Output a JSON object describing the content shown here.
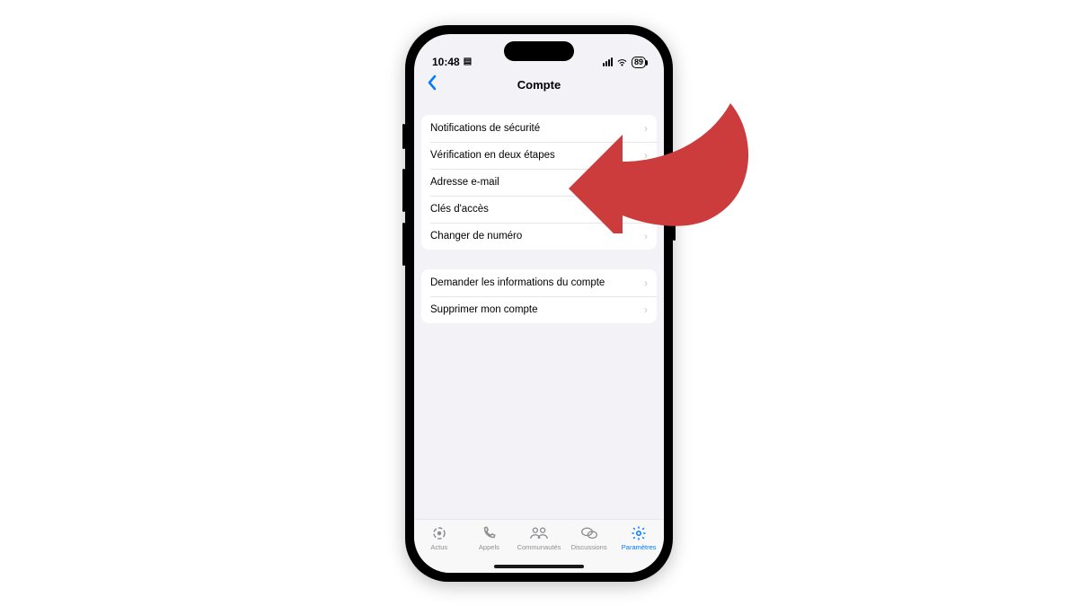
{
  "status": {
    "time": "10:48",
    "battery": "89"
  },
  "nav": {
    "title": "Compte"
  },
  "group1": [
    "Notifications de sécurité",
    "Vérification en deux étapes",
    "Adresse e-mail",
    "Clés d'accès",
    "Changer de numéro"
  ],
  "group2": [
    "Demander les informations du compte",
    "Supprimer mon compte"
  ],
  "tabs": [
    {
      "label": "Actus"
    },
    {
      "label": "Appels"
    },
    {
      "label": "Communautés"
    },
    {
      "label": "Discussions"
    },
    {
      "label": "Paramètres"
    }
  ]
}
